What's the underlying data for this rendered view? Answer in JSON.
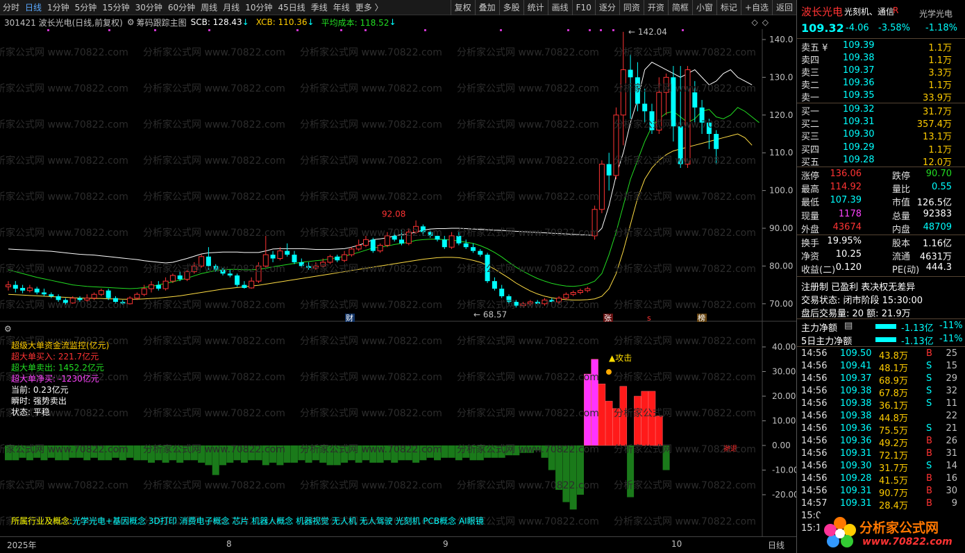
{
  "toolbar": {
    "tabs": [
      "分时",
      "日线",
      "1分钟",
      "5分钟",
      "15分钟",
      "30分钟",
      "60分钟",
      "周线",
      "月线",
      "10分钟",
      "45日线",
      "季线",
      "年线",
      "更多 〉"
    ],
    "active_tab": "日线",
    "buttons": [
      "复权",
      "叠加",
      "多股",
      "统计",
      "画线",
      "F10",
      "逐分",
      "同资",
      "开资",
      "简框",
      "小窗",
      "标记",
      "+自选",
      "返回"
    ]
  },
  "info": {
    "code_name": "301421 波长光电(日线,前复权)",
    "indicator": "筹码跟踪主图",
    "scb": "SCB: 128.43",
    "xcb": "XCB: 110.36",
    "avg": "平均成本: 118.52"
  },
  "colors": {
    "up": "#ff3333",
    "down": "#00ffff",
    "ma_white": "#ffffff",
    "ma_green": "#22dd22",
    "ma_gold": "#ffdd44",
    "bg": "#000000"
  },
  "main_chart": {
    "y_ticks": [
      "140.0",
      "130.0",
      "120.0",
      "110.0",
      "100.0",
      "90.00",
      "80.00",
      "70.00"
    ],
    "labels": {
      "high": "142.04",
      "peak": "92.08",
      "low": "68.57"
    },
    "event_marks": {
      "cai": "财",
      "zhang": "张",
      "s": "s",
      "bang": "榜"
    }
  },
  "candles": [
    [
      74.5,
      75,
      73.5,
      76
    ],
    [
      75,
      74,
      73,
      76
    ],
    [
      74.2,
      73.5,
      72.8,
      75
    ],
    [
      73.5,
      74.2,
      73,
      75
    ],
    [
      74,
      73,
      72.5,
      74.5
    ],
    [
      73,
      72.5,
      72,
      74
    ],
    [
      72.5,
      72,
      71.5,
      73
    ],
    [
      72,
      71,
      70.5,
      72.5
    ],
    [
      71,
      70.2,
      69.8,
      71.5
    ],
    [
      70.2,
      71.5,
      70,
      72
    ],
    [
      71.5,
      71,
      70.5,
      72
    ],
    [
      71,
      71.5,
      70.5,
      72.5
    ],
    [
      71.5,
      72.5,
      71,
      73
    ],
    [
      72.5,
      73.5,
      72,
      74
    ],
    [
      73.5,
      71.5,
      71,
      74
    ],
    [
      71.5,
      70.5,
      70,
      72
    ],
    [
      70.5,
      70,
      69.8,
      71
    ],
    [
      70,
      71.5,
      69.8,
      72
    ],
    [
      71.5,
      72.5,
      71,
      73
    ],
    [
      72.5,
      74,
      72,
      75
    ],
    [
      74,
      75,
      73,
      76
    ],
    [
      75,
      74,
      73.5,
      76
    ],
    [
      74,
      76,
      73.5,
      77
    ],
    [
      76,
      77.5,
      75.5,
      78
    ],
    [
      77.5,
      76.5,
      76,
      78.5
    ],
    [
      76.5,
      78.5,
      76,
      79
    ],
    [
      78.5,
      80,
      78,
      81
    ],
    [
      80,
      82.5,
      79.5,
      83
    ],
    [
      82.5,
      80,
      79,
      85
    ],
    [
      80,
      79,
      78.5,
      80.5
    ],
    [
      79,
      78,
      77.5,
      79.5
    ],
    [
      78,
      77.5,
      77,
      79
    ],
    [
      77.5,
      75,
      74.5,
      78
    ],
    [
      75,
      74.2,
      74,
      76
    ],
    [
      74.2,
      76,
      74,
      77
    ],
    [
      76,
      80,
      75.5,
      81
    ],
    [
      80,
      83,
      79.5,
      88
    ],
    [
      83,
      82,
      81,
      84
    ],
    [
      82,
      84,
      81.5,
      85
    ],
    [
      84,
      83,
      82.5,
      86
    ],
    [
      83,
      81,
      80.5,
      84
    ],
    [
      81,
      80,
      79.5,
      82
    ],
    [
      80,
      79.5,
      79,
      81
    ],
    [
      79.5,
      80,
      79,
      81
    ],
    [
      80,
      81,
      79.5,
      82
    ],
    [
      81,
      82.5,
      80.5,
      83
    ],
    [
      82.5,
      81.5,
      81,
      83
    ],
    [
      81.5,
      83,
      81,
      84
    ],
    [
      83,
      84.5,
      82.5,
      85
    ],
    [
      84.5,
      85.5,
      84,
      87
    ],
    [
      85.5,
      87,
      85,
      88
    ],
    [
      87,
      84,
      83.5,
      87.5
    ],
    [
      84,
      85.5,
      83.5,
      86
    ],
    [
      85.5,
      88,
      85,
      89
    ],
    [
      88,
      87,
      86.5,
      89
    ],
    [
      87,
      86,
      85.5,
      89.5
    ],
    [
      86,
      89,
      85.5,
      90
    ],
    [
      89,
      90.5,
      88.5,
      92.08
    ],
    [
      90.5,
      89,
      88,
      91
    ],
    [
      89,
      88,
      87.5,
      89.5
    ],
    [
      88,
      87,
      86.5,
      88.5
    ],
    [
      87,
      85,
      84.5,
      88
    ],
    [
      85,
      88,
      84.5,
      89
    ],
    [
      88,
      86,
      85.5,
      89
    ],
    [
      86,
      85,
      84.5,
      87
    ],
    [
      85,
      84,
      83.5,
      86
    ],
    [
      84,
      83,
      82.5,
      84.5
    ],
    [
      83,
      76,
      75.5,
      83.5
    ],
    [
      76,
      74,
      73.5,
      77
    ],
    [
      74,
      72,
      71.5,
      75
    ],
    [
      72,
      70.5,
      70,
      72.5
    ],
    [
      70.5,
      69.5,
      69,
      71
    ],
    [
      69.5,
      70,
      69,
      70.5
    ],
    [
      70,
      70.5,
      69.5,
      71
    ],
    [
      70.5,
      70,
      69.8,
      71
    ],
    [
      70,
      71,
      69.5,
      71.5
    ],
    [
      71,
      70.5,
      70,
      71.5
    ],
    [
      70.5,
      71.5,
      70,
      72
    ],
    [
      71.5,
      72.5,
      71,
      73
    ],
    [
      72.5,
      73,
      72,
      73.5
    ],
    [
      73,
      73.5,
      72.5,
      74
    ],
    [
      73.5,
      74,
      73,
      74.5
    ],
    [
      88,
      95,
      87,
      96
    ],
    [
      95,
      107,
      94,
      108
    ],
    [
      107,
      104,
      100,
      110
    ],
    [
      104,
      120,
      103,
      122
    ],
    [
      120,
      132,
      112,
      142.04
    ],
    [
      132,
      130,
      119,
      136
    ],
    [
      130,
      123,
      121,
      134
    ],
    [
      123,
      121,
      118,
      127
    ],
    [
      121,
      116,
      115,
      123
    ],
    [
      116,
      126,
      115,
      130
    ],
    [
      126,
      130,
      120,
      131
    ],
    [
      130,
      117,
      113,
      133
    ],
    [
      117,
      107,
      106,
      133
    ],
    [
      107,
      132,
      106,
      133
    ],
    [
      126,
      122,
      118,
      129
    ],
    [
      122,
      118,
      115,
      124
    ],
    [
      118,
      115,
      111,
      119
    ],
    [
      115,
      111,
      107,
      116
    ]
  ],
  "ma_white": [
    84.5,
    84.4,
    84.3,
    84.2,
    84.1,
    84,
    83.9,
    83.7,
    83.5,
    83.3,
    83.1,
    83,
    82.9,
    82.7,
    82.5,
    82.3,
    82.1,
    81.9,
    81.7,
    81.4,
    81.2,
    81,
    80.8,
    81,
    81.5,
    82,
    82.6,
    83.2,
    83.5,
    83.6,
    83.7,
    83.7,
    83.7,
    83.6,
    83.6,
    83.6,
    84,
    84.5,
    84.6,
    84.6,
    84.6,
    84.6,
    84.5,
    84.4,
    84.4,
    84.4,
    84.5,
    84.6,
    85,
    85.5,
    86.2,
    87,
    87.2,
    87.5,
    88,
    88.3,
    88.5,
    89,
    89.5,
    89.8,
    89.9,
    89.9,
    90,
    90,
    89.9,
    89.8,
    89.7,
    89.6,
    89.5,
    89.4,
    89.3,
    89.2,
    89.1,
    89,
    88.9,
    88.8,
    88.7,
    88.6,
    88.5,
    88.4,
    88.3,
    88.2,
    88.1,
    90,
    96,
    104,
    110,
    118,
    124,
    132,
    134,
    133,
    132,
    131,
    130,
    131,
    132,
    130,
    128,
    129,
    131,
    132,
    130,
    129,
    128
  ],
  "ma_green": [
    79,
    78.5,
    78,
    77.5,
    77,
    76.6,
    76.2,
    75.8,
    75.4,
    75,
    74.8,
    74.6,
    74.5,
    74.4,
    74.3,
    74.2,
    74.1,
    74,
    74.1,
    74.3,
    74.6,
    75,
    75.4,
    75.8,
    76.3,
    76.8,
    77.4,
    78,
    78.4,
    78.8,
    79,
    79.1,
    79.1,
    79,
    79,
    79.1,
    79.4,
    79.8,
    80.1,
    80.4,
    80.7,
    81,
    81.2,
    81.4,
    81.6,
    81.9,
    82.2,
    82.6,
    83.1,
    83.6,
    84.2,
    84.8,
    85,
    85.3,
    85.7,
    86,
    86.3,
    86.8,
    87,
    87.1,
    87.1,
    87,
    86.9,
    86.6,
    86.3,
    86,
    85.4,
    84.6,
    83.6,
    82.4,
    81,
    79.7,
    78.6,
    77.6,
    76.7,
    76,
    75.4,
    75,
    74.7,
    74.6,
    74.8,
    75.2,
    76,
    78,
    83,
    89,
    96,
    103,
    108,
    113,
    117,
    119,
    120.5,
    121,
    119.5,
    118,
    119,
    121,
    121.5,
    119.5,
    119,
    120,
    122,
    121,
    119.5,
    118
  ],
  "ma_gold": [
    72.5,
    72.4,
    72.3,
    72.2,
    72.1,
    72,
    71.9,
    71.8,
    71.7,
    71.6,
    71.5,
    71.5,
    71.4,
    71.4,
    71.3,
    71.3,
    71.2,
    71.2,
    71.2,
    71.3,
    71.4,
    71.5,
    71.7,
    71.9,
    72.1,
    72.4,
    72.7,
    73,
    73.3,
    73.6,
    73.9,
    74.1,
    74.3,
    74.5,
    74.7,
    74.9,
    75.2,
    75.5,
    75.8,
    76.1,
    76.4,
    76.7,
    77,
    77.3,
    77.6,
    77.9,
    78.2,
    78.5,
    78.8,
    79.1,
    79.4,
    79.7,
    80,
    80.3,
    80.6,
    80.9,
    81.2,
    81.5,
    81.8,
    82,
    82.2,
    82.3,
    82.3,
    82.2,
    81.9,
    81.5,
    81,
    80.2,
    79.2,
    78,
    76.8,
    75.5,
    74.4,
    73.4,
    72.6,
    72,
    71.6,
    71.3,
    71.1,
    71,
    71,
    71.1,
    71.3,
    72,
    74,
    78,
    84,
    91,
    98,
    103,
    106,
    108,
    109.5,
    110.5,
    111,
    111.5,
    112,
    112.5,
    113,
    113.5,
    114,
    114.5,
    115,
    114,
    112
  ],
  "indicator": {
    "title": "超级资金监控",
    "y_ticks": [
      "40.00",
      "30.00",
      "20.00",
      "10.00",
      "0.00",
      "-10.00",
      "-20.00"
    ],
    "lines": {
      "l1": "超级大单资金流监控(亿元)",
      "l2": "超大单买入: 221.7亿元",
      "l3": "超大单卖出: 1452.2亿元",
      "l4": "超大单净买: -1230亿元",
      "l5": "当前: 0.23亿元",
      "l6": "瞬时: 强势卖出",
      "l7": "状态: 平稳",
      "attack": "▲攻击",
      "retreat": "撤退"
    },
    "bars": [
      -6,
      -6,
      -5,
      -6,
      -5,
      -6,
      -5,
      -6,
      -6,
      -5,
      -5,
      -6,
      -5,
      -6,
      -6,
      -5,
      -6,
      -5,
      -6,
      -6,
      -7,
      -6,
      -7,
      -6,
      -7,
      -6,
      -6,
      -7,
      -8,
      -12,
      -8,
      -7,
      -6,
      -7,
      -6,
      -6,
      -8,
      -7,
      -8,
      -7,
      -7,
      -6,
      -7,
      -6,
      -7,
      -8,
      -8,
      -7,
      -6,
      -7,
      -6,
      -7,
      -7,
      -6,
      -7,
      -6,
      -6,
      -7,
      -6,
      -5,
      -6,
      -5,
      -5,
      -6,
      -5,
      -6,
      -6,
      -5,
      -5,
      -5,
      -4,
      -4,
      -3,
      -3,
      -2,
      -5,
      -10,
      -18,
      -23,
      -26,
      -20,
      29,
      35,
      25,
      18,
      15,
      24,
      -21,
      20,
      22,
      22,
      12,
      -10
    ]
  },
  "concepts": {
    "label": "所属行业及概念:",
    "list": "光学光电+基因概念  3D打印  消费电子概念  芯片  机器人概念  机器视觉  无人机  无人驾驶  光刻机  PCB概念  AI眼镜"
  },
  "time_axis": {
    "year": "2025年",
    "m8": "8",
    "m9": "9",
    "m10": "10",
    "period": "日线"
  },
  "watermark": "分析家公式网  www.70822.com",
  "side": {
    "name": "波长光电",
    "concept": "光刻机、通信",
    "flag": "R",
    "sector": "光学光电",
    "price": "109.32",
    "change": "-4.06",
    "pct": "-3.58%",
    "sector_pct": "-1.18%",
    "asks": [
      [
        "卖五 ¥",
        "109.39",
        "1.1万"
      ],
      [
        "卖四",
        "109.38",
        "1.1万"
      ],
      [
        "卖三",
        "109.37",
        "3.3万"
      ],
      [
        "卖二",
        "109.36",
        "1.1万"
      ],
      [
        "卖一",
        "109.35",
        "33.9万"
      ]
    ],
    "bids": [
      [
        "买一",
        "109.32",
        "31.7万"
      ],
      [
        "买二",
        "109.31",
        "357.4万"
      ],
      [
        "买三",
        "109.30",
        "13.1万"
      ],
      [
        "买四",
        "109.29",
        "1.1万"
      ],
      [
        "买五",
        "109.28",
        "12.0万"
      ]
    ],
    "stats": [
      [
        "涨停",
        "136.06",
        "跌停",
        "90.70"
      ],
      [
        "最高",
        "114.92",
        "量比",
        "0.55"
      ],
      [
        "最低",
        "107.39",
        "市值",
        "126.5亿"
      ],
      [
        "现量",
        "1178",
        "总量",
        "92383"
      ],
      [
        "外盘",
        "43674",
        "内盘",
        "48709"
      ]
    ],
    "stats2": [
      [
        "换手",
        "19.95%",
        "股本",
        "1.16亿"
      ],
      [
        "净资",
        "10.25",
        "流通",
        "4631万"
      ],
      [
        "收益(二)",
        "0.120",
        "PE(动)",
        "444.3"
      ]
    ],
    "reg": "注册制  已盈利  表决权无差异",
    "trade_status": "交易状态: 闭市阶段 15:30:00",
    "after": "盘后交易量: 20  额: 21.9万",
    "main_flow": [
      "主力净额",
      "-1.13亿",
      "-11%"
    ],
    "main_flow5": [
      "5日主力净额",
      "-1.13亿",
      "-11%"
    ],
    "ticks": [
      [
        "14:56",
        "109.50",
        "43.8万",
        "B",
        "25"
      ],
      [
        "14:56",
        "109.41",
        "48.1万",
        "S",
        "15"
      ],
      [
        "14:56",
        "109.37",
        "68.9万",
        "S",
        "29"
      ],
      [
        "14:56",
        "109.38",
        "67.8万",
        "S",
        "32"
      ],
      [
        "14:56",
        "109.38",
        "36.1万",
        "S",
        "11"
      ],
      [
        "14:56",
        "109.38",
        "44.8万",
        "",
        "22"
      ],
      [
        "14:56",
        "109.36",
        "75.5万",
        "S",
        "21"
      ],
      [
        "14:56",
        "109.36",
        "49.2万",
        "B",
        "26"
      ],
      [
        "14:56",
        "109.31",
        "72.1万",
        "B",
        "31"
      ],
      [
        "14:56",
        "109.30",
        "31.7万",
        "S",
        "14"
      ],
      [
        "14:56",
        "109.28",
        "41.5万",
        "B",
        "16"
      ],
      [
        "14:56",
        "109.31",
        "90.7万",
        "B",
        "30"
      ],
      [
        "14:57",
        "109.31",
        "28.4万",
        "B",
        "9"
      ],
      [
        "15:0",
        "",
        "",
        "",
        ""
      ],
      [
        "15:1",
        "",
        "",
        "",
        ""
      ]
    ],
    "logo_text": "分析家公式网",
    "logo_url": "www.70822.com"
  }
}
